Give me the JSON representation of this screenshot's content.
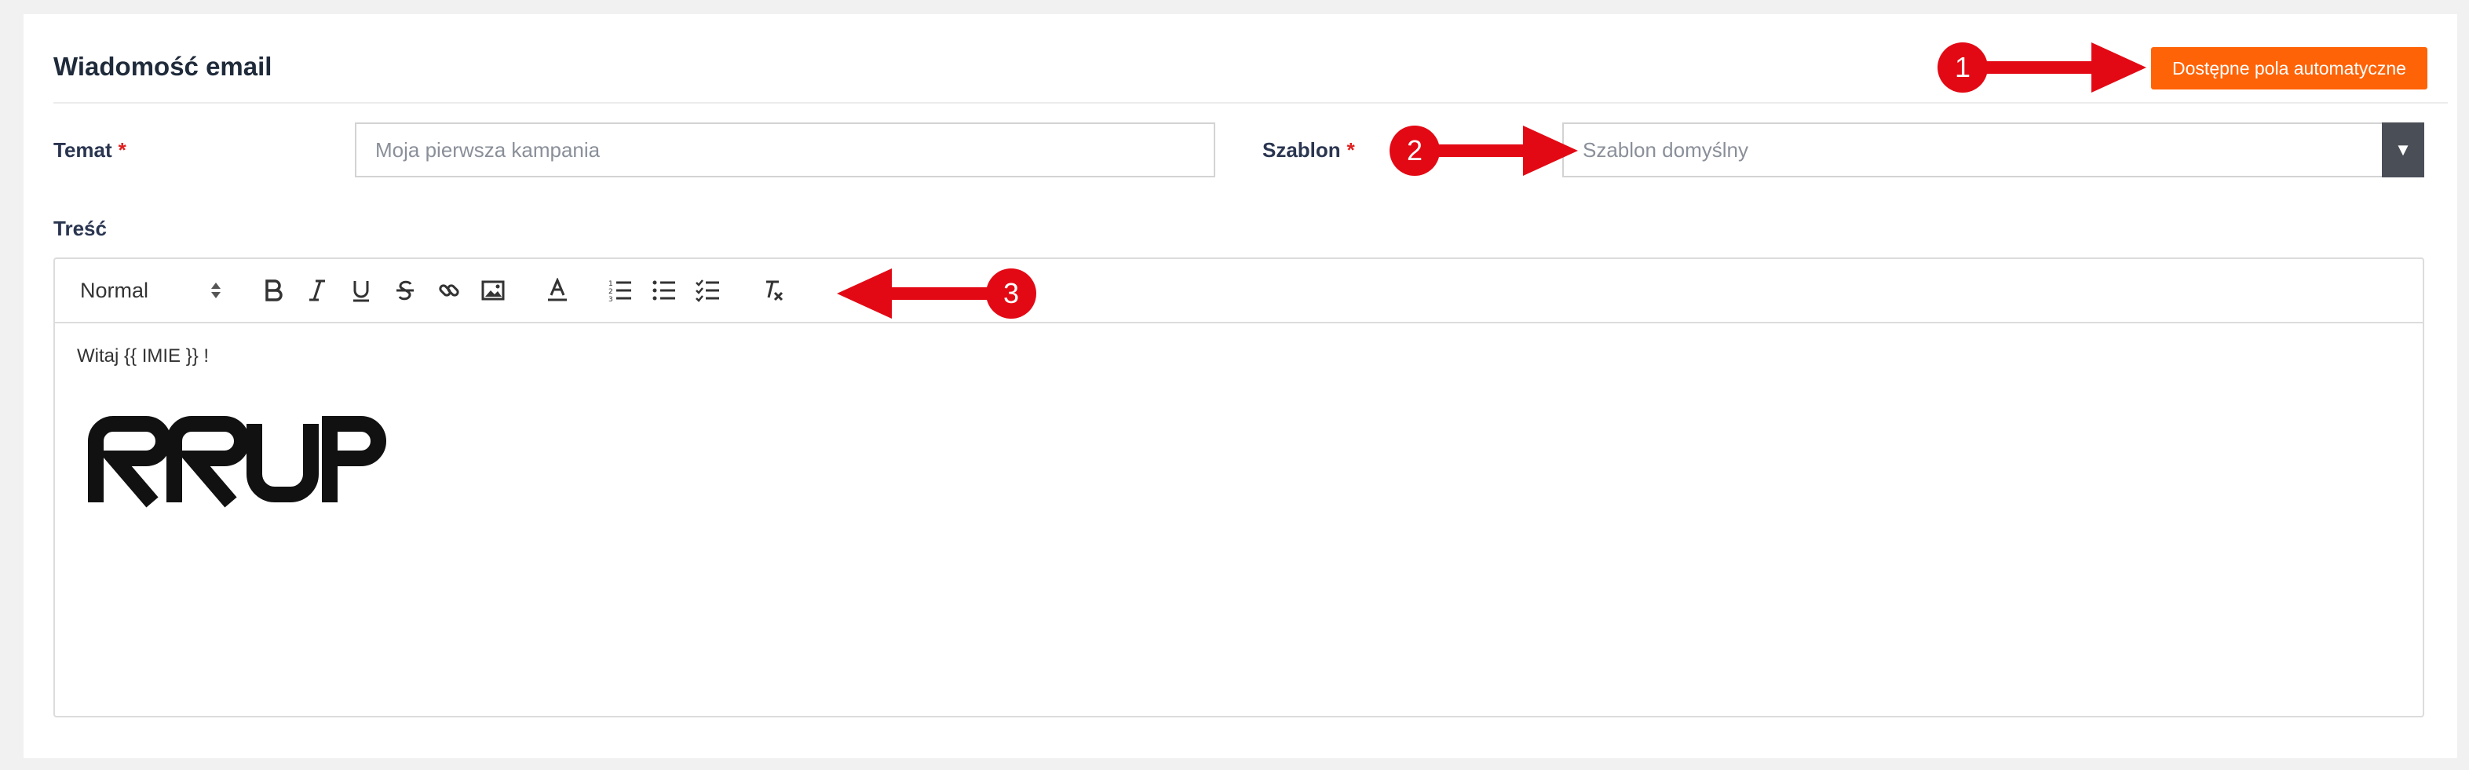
{
  "form": {
    "title": "Wiadomość email",
    "auto_fields_button": "Dostępne pola automatyczne",
    "subject_label": "Temat",
    "required_mark": "*",
    "subject_placeholder": "Moja pierwsza kampania",
    "template_label": "Szablon",
    "template_selected": "Szablon domyślny",
    "body_label": "Treść"
  },
  "editor": {
    "format_select": "Normal",
    "content_text": "Witaj {{ IMIE }} !",
    "toolbar_icons": [
      "bold-icon",
      "italic-icon",
      "underline-icon",
      "strikethrough-icon",
      "link-icon",
      "image-icon",
      "text-color-icon",
      "ordered-list-icon",
      "bullet-list-icon",
      "checklist-icon",
      "clear-format-icon"
    ]
  },
  "logo": {
    "brand_text": "RRUP"
  },
  "annotations": {
    "badge_1": "1",
    "badge_2": "2",
    "badge_3": "3"
  },
  "colors": {
    "accent": "#ff6307",
    "annotation_red": "#e30914",
    "required": "#e0201f"
  }
}
